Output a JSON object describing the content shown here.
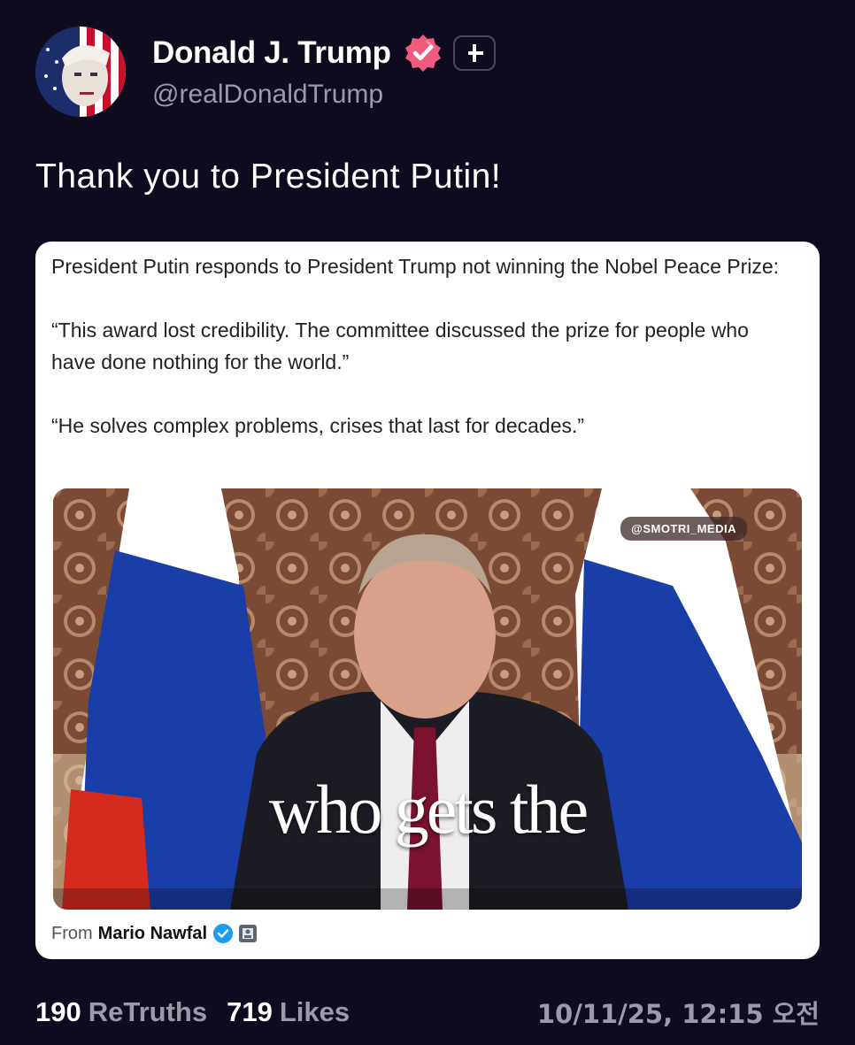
{
  "post": {
    "author": {
      "display_name": "Donald J. Trump",
      "handle": "@realDonaldTrump",
      "verified_icon": "verified-badge-icon",
      "follow_icon": "plus-icon"
    },
    "text": "Thank you to President Putin!",
    "embed": {
      "paragraphs": [
        "President Putin responds to President Trump not winning the Nobel Peace Prize:",
        "“This award lost credibility. The committee discussed the prize for people who have done nothing for the world.”",
        "“He solves complex problems, crises that last for decades.”"
      ],
      "video": {
        "watermark": "@SMOTRI_MEDIA",
        "caption": "who gets the"
      },
      "attribution": {
        "prefix": "From",
        "author": "Mario Nawfal"
      }
    },
    "stats": {
      "retruths_count": "190",
      "retruths_label": "ReTruths",
      "likes_count": "719",
      "likes_label": "Likes",
      "timestamp": "10/11/25, 12:15 오전"
    }
  },
  "colors": {
    "background": "#0d0b1d",
    "verified_badge": "#f05a7e",
    "secondary_text": "#9a9aa8"
  }
}
